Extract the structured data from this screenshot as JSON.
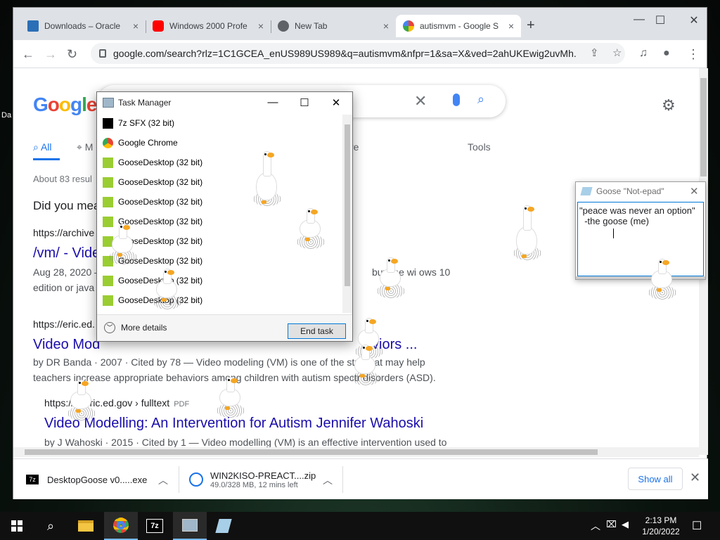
{
  "desktop": {
    "icon_label": "Da"
  },
  "chrome": {
    "tabs": [
      {
        "title": "Downloads – Oracle",
        "close": "×"
      },
      {
        "title": "Windows 2000 Profe",
        "close": "×"
      },
      {
        "title": "New Tab",
        "close": "×"
      },
      {
        "title": "autismvm - Google S",
        "close": "×"
      }
    ],
    "new_tab": "+",
    "url": "google.com/search?rlz=1C1GCEA_enUS989US989&q=autismvm&nfpr=1&sa=X&ved=2ahUKEwig2uvMh..."
  },
  "google": {
    "logo": "Google",
    "tabs": [
      {
        "label": "All"
      },
      {
        "label": "M"
      },
      {
        "label": "re"
      },
      {
        "label": "Tools"
      }
    ],
    "about": "About 83 resul",
    "did_you_mean": "Did you mea",
    "results": [
      {
        "url": "https://archive",
        "title": "/vm/ - Vide",
        "snippet_a": "Aug 28, 2020 —",
        "snippet_b": "edition or java",
        "snippet_c": "buy the wi   ows 10"
      },
      {
        "url": "https://eric.ed.",
        "title": "Video Mod",
        "title_end": "viors ...",
        "snippet_a": "by DR Banda · 2007 · Cited by 78 — Video modeling (VM) is one of the stra       that may help",
        "snippet_b": "teachers increase appropriate behaviors among children with autism spectr    disorders (ASD)."
      },
      {
        "url": "https://       s.eric.ed.gov › fulltext",
        "pdf": "PDF",
        "title": "Video Modelling: An Intervention for Autism Jennifer Wahoski",
        "snippet_a": "by J Wahoski · 2015 · Cited by 1 — Video modelling (VM) is an effective intervention used to"
      }
    ]
  },
  "downloads": [
    {
      "name": "DesktopGoose v0.....exe",
      "sub": ""
    },
    {
      "name": "WIN2KISO-PREACT....zip",
      "sub": "49.0/328 MB, 12 mins left"
    }
  ],
  "show_all": "Show all",
  "taskmgr": {
    "title": "Task Manager",
    "rows": [
      {
        "label": "7z SFX (32 bit)",
        "icon": "7z-icon"
      },
      {
        "label": "Google Chrome",
        "icon": "chrome-icon"
      },
      {
        "label": "GooseDesktop (32 bit)",
        "icon": "goose-app-icon"
      },
      {
        "label": "GooseDesktop (32 bit)",
        "icon": "goose-app-icon"
      },
      {
        "label": "GooseDesktop (32 bit)",
        "icon": "goose-app-icon"
      },
      {
        "label": "GooseDesktop (32 bit)",
        "icon": "goose-app-icon"
      },
      {
        "label": "GooseDesktop (32 bit)",
        "icon": "goose-app-icon"
      },
      {
        "label": "GooseDesktop (32 bit)",
        "icon": "goose-app-icon"
      },
      {
        "label": "GooseDesktop (32 bit)",
        "icon": "goose-app-icon"
      },
      {
        "label": "GooseDesktop (32 bit)",
        "icon": "goose-app-icon"
      }
    ],
    "more_details": "More details",
    "end_task": "End task"
  },
  "notepad": {
    "title": "Goose \"Not-epad\"",
    "line1": "\"peace was never an option\"",
    "line2": "  -the goose (me)"
  },
  "clock": {
    "time": "2:13 PM",
    "date": "1/20/2022"
  },
  "colors": {
    "accent": "#1a73e8",
    "link": "#1a0dab",
    "goose_beak": "#f5a623"
  }
}
